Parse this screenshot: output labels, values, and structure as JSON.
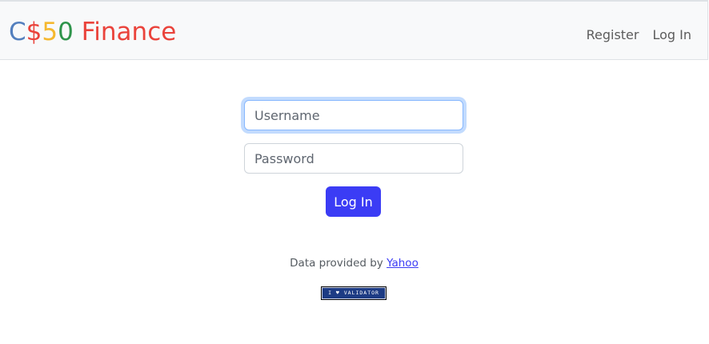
{
  "navbar": {
    "brand": {
      "c": "C",
      "dollar": "$",
      "five": "5",
      "zero": "0",
      "name": " Finance"
    },
    "links": {
      "register": "Register",
      "login": "Log In"
    }
  },
  "form": {
    "username": {
      "placeholder": "Username",
      "value": ""
    },
    "password": {
      "placeholder": "Password",
      "value": ""
    },
    "submit_label": "Log In"
  },
  "footer": {
    "text": "Data provided by ",
    "link": "Yahoo",
    "badge": "I ♥ VALIDATOR"
  },
  "colors": {
    "brand_blue": "#537fbe",
    "brand_red": "#ea433b",
    "brand_yellow": "#f5b82e",
    "brand_green": "#2e944b",
    "primary": "#3b3cf5"
  }
}
